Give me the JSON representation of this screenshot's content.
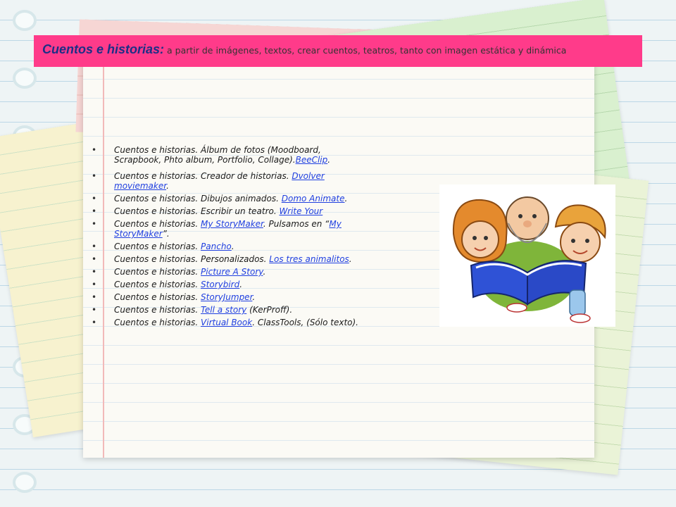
{
  "slide": {
    "title_strong": "Cuentos e historias:",
    "title_rest": " a partir de imágenes, textos, crear cuentos, teatros, tanto con imagen estática y dinámica"
  },
  "items": [
    {
      "text": "Cuentos e historias. Álbum de fotos (Moodboard, Scrapbook, Phto album, Portfolio, Collage).",
      "link": "BeeClip",
      "after": "."
    },
    {
      "text": "Cuentos e historias. Creador de historias.  ",
      "link": "Dvolver moviemaker",
      "after": "."
    },
    {
      "text": "Cuentos e historias. Dibujos animados. ",
      "link": "Domo Animate",
      "after": "."
    },
    {
      "text": "Cuentos e historias. Escribir un teatro. ",
      "link": "Write Your",
      "after": ""
    },
    {
      "text": "Cuentos e historias. ",
      "link": "My StoryMaker",
      "after": ". Pulsamos en “",
      "link2": "My StoryMaker",
      "after2": "”."
    },
    {
      "text": "Cuentos e historias. ",
      "link": "Pancho",
      "after": "."
    },
    {
      "text": "Cuentos e historias. Personalizados. ",
      "link": "Los tres animalitos",
      "after": "."
    },
    {
      "text": "Cuentos e historias. ",
      "link": "Picture A Story",
      "after": "."
    },
    {
      "text": "Cuentos e historias. ",
      "link": "Storybird",
      "after": "."
    },
    {
      "text": "Cuentos e historias. ",
      "link": "StoryJumper",
      "after": "."
    },
    {
      "text": "Cuentos e historias. ",
      "link": "Tell a story",
      "after": " (KerProff)."
    },
    {
      "text": "Cuentos e historias. ",
      "link": "Virtual Book",
      "after": ". ClassTools, (Sólo texto)."
    }
  ],
  "bullet_char": "•",
  "colors": {
    "title_bar": "#ff3b8a",
    "title_strong": "#1c2f86",
    "link": "#1f3fe0"
  },
  "image": {
    "icon": "grandfather-reading-book-to-children-illustration"
  }
}
